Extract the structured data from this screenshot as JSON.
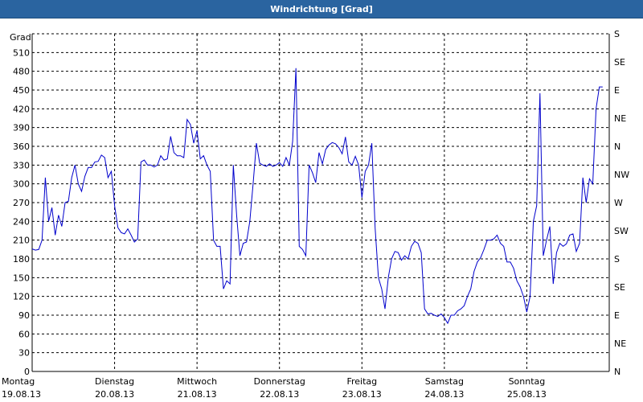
{
  "window": {
    "title": "Windrichtung [Grad]"
  },
  "colors": {
    "titlebar": "#2a64a0",
    "line": "#0000cc",
    "grid": "#000000",
    "background": "#ffffff"
  },
  "chart_data": {
    "type": "line",
    "title": "Windrichtung [Grad]",
    "ylabel": "Grad",
    "ylim": [
      0,
      540
    ],
    "yticks": [
      0,
      30,
      60,
      90,
      120,
      150,
      180,
      210,
      240,
      270,
      300,
      330,
      360,
      390,
      420,
      450,
      480,
      510
    ],
    "y2ticks": [
      {
        "value": 0,
        "label": "N"
      },
      {
        "value": 45,
        "label": "NE"
      },
      {
        "value": 90,
        "label": "E"
      },
      {
        "value": 135,
        "label": "SE"
      },
      {
        "value": 180,
        "label": "S"
      },
      {
        "value": 225,
        "label": "SW"
      },
      {
        "value": 270,
        "label": "W"
      },
      {
        "value": 315,
        "label": "NW"
      },
      {
        "value": 360,
        "label": "N"
      },
      {
        "value": 405,
        "label": "NE"
      },
      {
        "value": 450,
        "label": "E"
      },
      {
        "value": 495,
        "label": "SE"
      },
      {
        "value": 540,
        "label": "S"
      }
    ],
    "xlabels": [
      {
        "day": "Montag",
        "date": "19.08.13"
      },
      {
        "day": "Dienstag",
        "date": "20.08.13"
      },
      {
        "day": "Mittwoch",
        "date": "21.08.13"
      },
      {
        "day": "Donnerstag",
        "date": "22.08.13"
      },
      {
        "day": "Freitag",
        "date": "23.08.13"
      },
      {
        "day": "Samstag",
        "date": "24.08.13"
      },
      {
        "day": "Sonntag",
        "date": "25.08.13"
      }
    ],
    "xlim": [
      0,
      7
    ],
    "grid": true,
    "series": [
      {
        "x": [
          0,
          0.04,
          0.08,
          0.12,
          0.16,
          0.2,
          0.24,
          0.28,
          0.32,
          0.36,
          0.4,
          0.44,
          0.48,
          0.52,
          0.56,
          0.6,
          0.64,
          0.68,
          0.72,
          0.76,
          0.8,
          0.84,
          0.88,
          0.92,
          0.96,
          1,
          1.04,
          1.08,
          1.12,
          1.16,
          1.2,
          1.24,
          1.28,
          1.32,
          1.36,
          1.4,
          1.44,
          1.48,
          1.52,
          1.56,
          1.6,
          1.64,
          1.68,
          1.72,
          1.76,
          1.8,
          1.84,
          1.88,
          1.92,
          1.96,
          2,
          2.04,
          2.08,
          2.12,
          2.16,
          2.2,
          2.24,
          2.28,
          2.32,
          2.36,
          2.4,
          2.44,
          2.48,
          2.52,
          2.56,
          2.6,
          2.64,
          2.68,
          2.72,
          2.76,
          2.8,
          2.84,
          2.88,
          2.92,
          2.96,
          3,
          3.04,
          3.08,
          3.12,
          3.16,
          3.2,
          3.24,
          3.28,
          3.32,
          3.36,
          3.4,
          3.44,
          3.48,
          3.52,
          3.56,
          3.6,
          3.64,
          3.68,
          3.72,
          3.76,
          3.8,
          3.84,
          3.88,
          3.92,
          3.96,
          4,
          4.04,
          4.08,
          4.12,
          4.16,
          4.2,
          4.24,
          4.28,
          4.32,
          4.36,
          4.4,
          4.44,
          4.48,
          4.52,
          4.56,
          4.6,
          4.64,
          4.68,
          4.72,
          4.76,
          4.8,
          4.84,
          4.88,
          4.92,
          4.96,
          5,
          5.04,
          5.08,
          5.12,
          5.16,
          5.2,
          5.24,
          5.28,
          5.32,
          5.36,
          5.4,
          5.44,
          5.48,
          5.52,
          5.56,
          5.6,
          5.64,
          5.68,
          5.72,
          5.76,
          5.8,
          5.84,
          5.88,
          5.92,
          5.96,
          6,
          6.04,
          6.08,
          6.12,
          6.16,
          6.2,
          6.24,
          6.28,
          6.32,
          6.36,
          6.4,
          6.44,
          6.48,
          6.52,
          6.56,
          6.6,
          6.64,
          6.68,
          6.72,
          6.76,
          6.8,
          6.84,
          6.88,
          6.92
        ],
        "values": [
          196,
          194,
          195,
          210,
          310,
          240,
          262,
          218,
          250,
          232,
          270,
          272,
          310,
          330,
          300,
          288,
          312,
          326,
          326,
          335,
          336,
          346,
          342,
          310,
          320,
          265,
          230,
          222,
          220,
          228,
          218,
          207,
          212,
          335,
          338,
          330,
          330,
          327,
          330,
          345,
          338,
          340,
          376,
          350,
          345,
          345,
          342,
          403,
          395,
          365,
          385,
          340,
          345,
          330,
          320,
          210,
          200,
          200,
          132,
          145,
          140,
          330,
          250,
          185,
          205,
          207,
          240,
          300,
          365,
          333,
          330,
          328,
          332,
          328,
          330,
          334,
          328,
          342,
          330,
          368,
          485,
          200,
          195,
          185,
          330,
          318,
          302,
          350,
          332,
          355,
          362,
          366,
          364,
          358,
          348,
          375,
          335,
          330,
          344,
          330,
          278,
          320,
          330,
          365,
          230,
          150,
          132,
          100,
          150,
          180,
          192,
          190,
          178,
          185,
          180,
          200,
          208,
          205,
          190,
          100,
          92,
          93,
          90,
          88,
          92,
          86,
          77,
          90,
          90,
          97,
          100,
          105,
          120,
          132,
          160,
          175,
          182,
          195,
          210,
          210,
          212,
          218,
          205,
          200,
          175,
          175,
          165,
          145,
          135,
          120,
          95,
          120,
          240,
          265,
          445,
          185,
          210,
          232,
          140,
          190,
          205,
          200,
          204,
          218,
          220,
          192,
          205,
          310,
          270,
          308,
          300,
          420,
          455,
          455
        ]
      }
    ]
  }
}
